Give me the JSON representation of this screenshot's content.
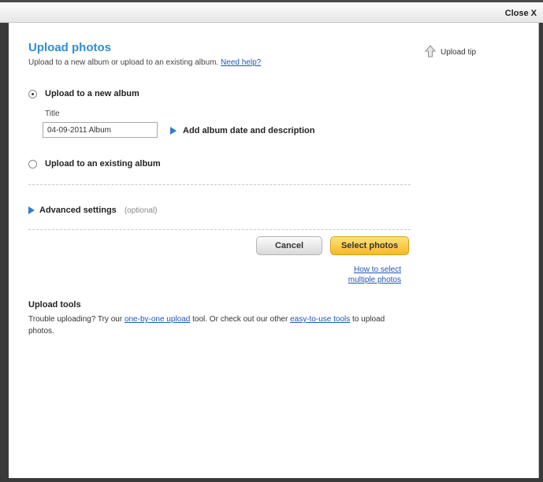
{
  "header": {
    "close_label": "Close X"
  },
  "dialog": {
    "title": "Upload photos",
    "subtitle": "Upload to a new album or upload to an existing album.",
    "help_link": "Need help?",
    "upload_tip": "Upload tip",
    "new_album": {
      "label": "Upload to a new album",
      "selected": true,
      "title_label": "Title",
      "title_value": "04-09-2011 Album",
      "add_details": "Add album date and description"
    },
    "existing_album": {
      "label": "Upload to an existing album",
      "selected": false
    },
    "advanced": {
      "label": "Advanced settings",
      "hint": "(optional)"
    },
    "buttons": {
      "cancel": "Cancel",
      "select": "Select photos"
    },
    "how_to": {
      "line1": "How to select",
      "line2": "multiple photos"
    },
    "tools": {
      "heading": "Upload tools",
      "text1": "Trouble uploading? Try our ",
      "link1": "one-by-one upload",
      "text2": " tool. Or check out our other ",
      "link2": "easy-to-use tools",
      "text3": " to upload photos."
    }
  },
  "colors": {
    "title": "#2f8fcf",
    "link": "#2155b8",
    "select_button": "#f6b923",
    "arrow": "#2f80c6"
  }
}
